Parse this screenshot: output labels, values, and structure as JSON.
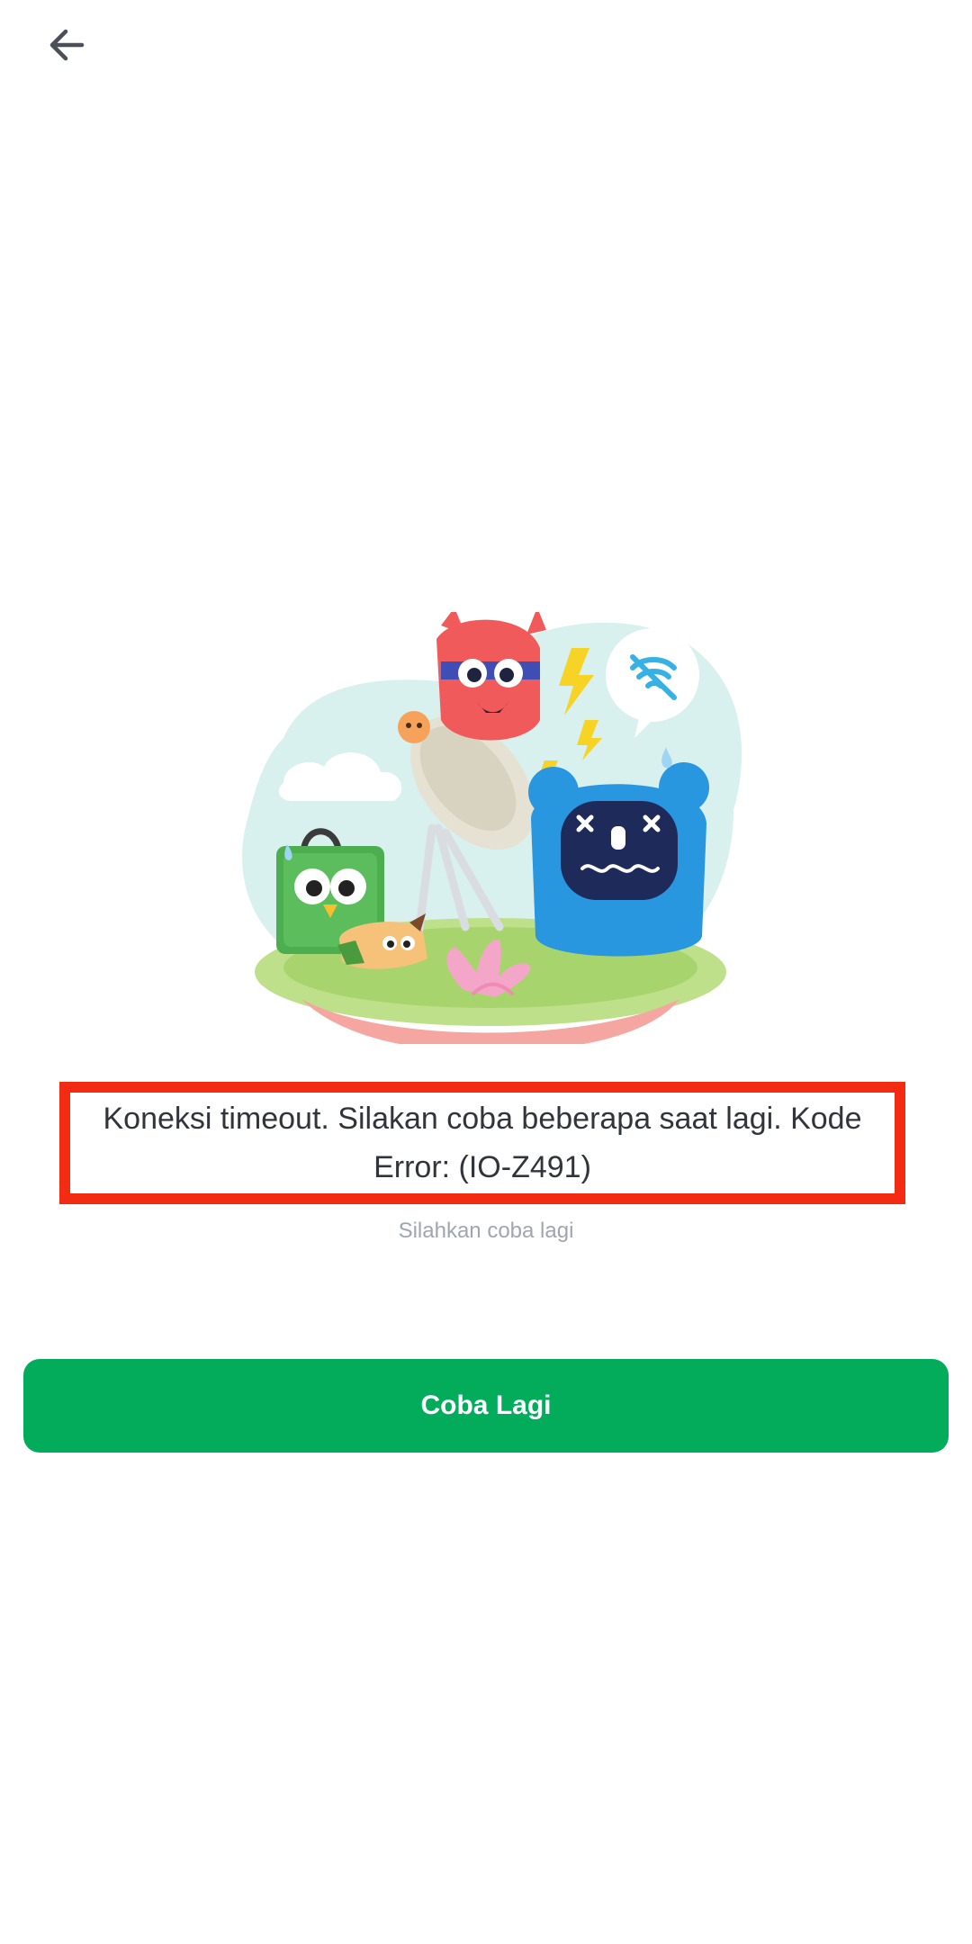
{
  "header": {
    "back_icon": "arrow-left-icon"
  },
  "illustration": {
    "description_icon": "connection-error-illustration"
  },
  "error": {
    "message": "Koneksi timeout. Silakan coba beberapa saat lagi. Kode Error: (IO-Z491)",
    "highlight_color": "#f32b12"
  },
  "subtitle": "Silahkan coba lagi",
  "retry_button": {
    "label": "Coba Lagi",
    "color": "#03ac5b"
  }
}
